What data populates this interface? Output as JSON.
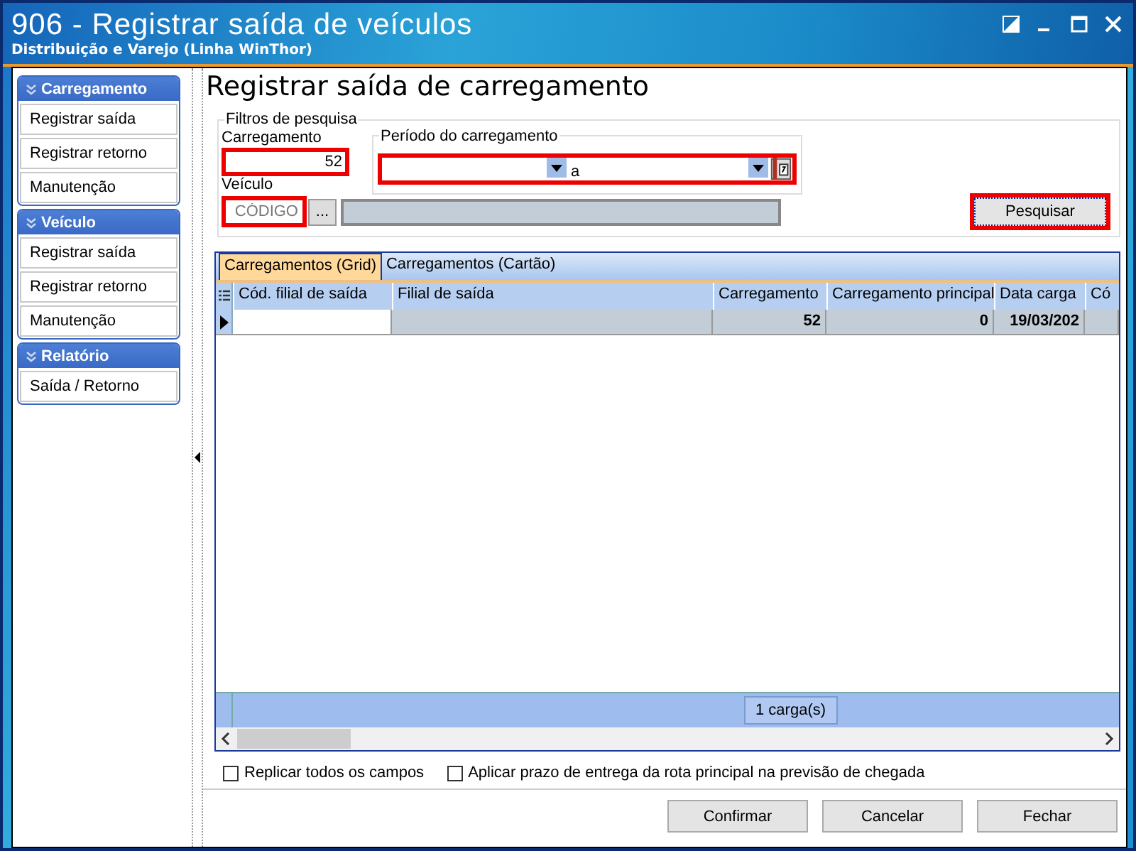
{
  "window": {
    "title": "906 - Registrar saída de veículos",
    "subtitle": "Distribuição e Varejo (Linha WinThor)"
  },
  "sidebar": [
    {
      "title": "Carregamento",
      "items": [
        {
          "label": "Registrar saída"
        },
        {
          "label": "Registrar retorno"
        },
        {
          "label": "Manutenção"
        }
      ]
    },
    {
      "title": "Veículo",
      "items": [
        {
          "label": "Registrar saída"
        },
        {
          "label": "Registrar retorno"
        },
        {
          "label": "Manutenção"
        }
      ]
    },
    {
      "title": "Relatório",
      "items": [
        {
          "label": "Saída / Retorno"
        }
      ]
    }
  ],
  "page_title": "Registrar saída de carregamento",
  "filters": {
    "legend": "Filtros de pesquisa",
    "carregamento": {
      "label": "Carregamento",
      "value": "52",
      "highlighted": true
    },
    "periodo": {
      "legend": "Período do carregamento",
      "separator": "a",
      "highlighted": true
    },
    "veiculo": {
      "label": "Veículo",
      "placeholder": "CÓDIGO",
      "lookup": "...",
      "highlighted": true
    },
    "search_button": {
      "label": "Pesquisar",
      "highlighted": true
    }
  },
  "tabs": [
    {
      "label": "Carregamentos (Grid)",
      "selected": true
    },
    {
      "label": "Carregamentos (Cartão)",
      "selected": false
    }
  ],
  "table": {
    "columns": [
      "Cód. filial de saída",
      "Filial de saída",
      "Carregamento",
      "Carregamento principal",
      "Data carga",
      "Có"
    ],
    "rows": [
      [
        "",
        "",
        "52",
        "0",
        "19/03/202",
        ""
      ]
    ],
    "footer": "1 carga(s)"
  },
  "options": [
    {
      "label": "Replicar todos os campos",
      "checked": false
    },
    {
      "label": "Aplicar prazo de entrega da rota principal na previsão de chegada",
      "checked": false
    }
  ],
  "buttons": [
    "Confirmar",
    "Cancelar",
    "Fechar"
  ]
}
